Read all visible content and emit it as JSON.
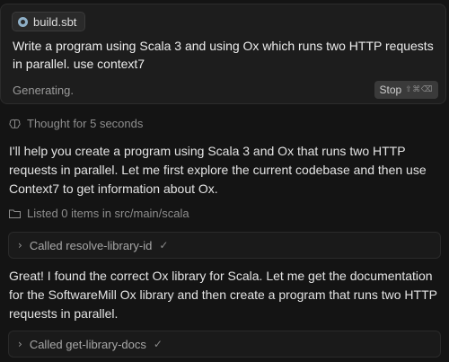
{
  "prompt": {
    "file_chip": "build.sbt",
    "text": "Write a program using Scala 3 and using Ox which runs two HTTP requests in parallel. use context7",
    "status": "Generating.",
    "stop_label": "Stop",
    "stop_shortcut": "⇧⌘⌫"
  },
  "thought": {
    "label": "Thought for 5 seconds"
  },
  "messages": {
    "para1": "I'll help you create a program using Scala 3 and Ox that runs two HTTP requests in parallel. Let me first explore the current codebase and then use Context7 to get information about Ox.",
    "para2": "Great! I found the correct Ox library for Scala. Let me get the documentation for the SoftwareMill Ox library and then create a program that runs two HTTP requests in parallel."
  },
  "listed": {
    "label": "Listed 0 items in src/main/scala"
  },
  "tools": [
    {
      "label": "Called resolve-library-id",
      "status": "✓"
    },
    {
      "label": "Called get-library-docs",
      "status": "✓"
    }
  ],
  "icons": {
    "file": "scala-file-icon",
    "thought": "brain-icon",
    "listed": "folder-icon",
    "expand": "chevron-right-icon",
    "done": "check-icon"
  }
}
